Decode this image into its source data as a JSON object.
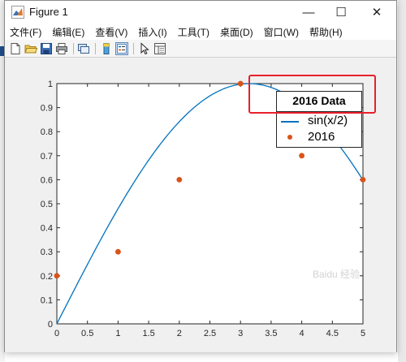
{
  "window": {
    "title": "Figure 1",
    "controls": {
      "minimize": "—",
      "maximize": "☐",
      "close": "✕"
    }
  },
  "menu": [
    {
      "label": "文件(F)"
    },
    {
      "label": "编辑(E)"
    },
    {
      "label": "查看(V)"
    },
    {
      "label": "插入(I)"
    },
    {
      "label": "工具(T)"
    },
    {
      "label": "桌面(D)"
    },
    {
      "label": "窗口(W)"
    },
    {
      "label": "帮助(H)"
    }
  ],
  "toolbar": {
    "icons": [
      "new-figure-icon",
      "open-file-icon",
      "save-icon",
      "print-icon",
      "link-plot-icon",
      "colorbar-icon",
      "legend-icon",
      "pointer-icon",
      "property-inspector-icon"
    ]
  },
  "colors": {
    "line_series": "#0072bd",
    "marker_series": "#d95319",
    "highlight": "#e8202a"
  },
  "chart_data": {
    "type": "line",
    "xlim": [
      0,
      5
    ],
    "ylim": [
      0,
      1
    ],
    "xticks": [
      "0",
      "0.5",
      "1",
      "1.5",
      "2",
      "2.5",
      "3",
      "3.5",
      "4",
      "4.5",
      "5"
    ],
    "yticks": [
      "0",
      "0.1",
      "0.2",
      "0.3",
      "0.4",
      "0.5",
      "0.6",
      "0.7",
      "0.8",
      "0.9",
      "1"
    ],
    "grid": false,
    "series": [
      {
        "name": "sin(x/2)",
        "style": "line",
        "function": "sin(x/2)",
        "x_range": [
          0,
          5
        ]
      },
      {
        "name": "2016",
        "style": "markers",
        "x": [
          0,
          1,
          2,
          3,
          4,
          5
        ],
        "y": [
          0.2,
          0.3,
          0.6,
          1.0,
          0.7,
          0.6
        ]
      }
    ],
    "legend": {
      "title": "2016 Data",
      "position": "northeast",
      "entries": [
        "sin(x/2)",
        "2016"
      ]
    }
  },
  "annotation": {
    "highlighted": "legend-title"
  }
}
